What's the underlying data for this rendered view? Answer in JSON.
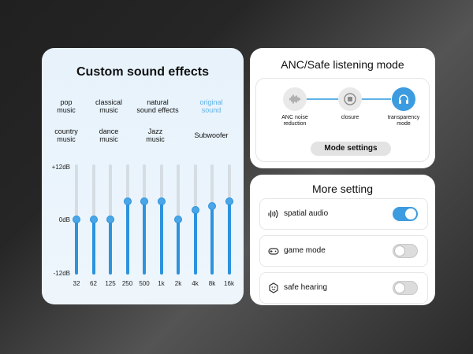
{
  "equalizer": {
    "title": "Custom sound effects",
    "presets": [
      {
        "label": "pop\nmusic",
        "active": false
      },
      {
        "label": "classical\nmusic",
        "active": false
      },
      {
        "label": "natural\nsound effects",
        "active": false
      },
      {
        "label": "original\nsound",
        "active": true
      },
      {
        "label": "country\nmusic",
        "active": false
      },
      {
        "label": "dance\nmusic",
        "active": false
      },
      {
        "label": "Jazz\nmusic",
        "active": false
      },
      {
        "label": "Subwoofer",
        "active": false
      }
    ],
    "y_labels": {
      "top": "+12dB",
      "mid": "0dB",
      "bottom": "-12dB"
    },
    "range": [
      -12,
      12
    ],
    "bands": [
      {
        "freq": "32",
        "gain_db": 0
      },
      {
        "freq": "62",
        "gain_db": 0
      },
      {
        "freq": "125",
        "gain_db": 0
      },
      {
        "freq": "250",
        "gain_db": 4
      },
      {
        "freq": "500",
        "gain_db": 4
      },
      {
        "freq": "1k",
        "gain_db": 4
      },
      {
        "freq": "2k",
        "gain_db": 0
      },
      {
        "freq": "4k",
        "gain_db": 2
      },
      {
        "freq": "8k",
        "gain_db": 3
      },
      {
        "freq": "16k",
        "gain_db": 4
      }
    ],
    "accent": "#2d93dd"
  },
  "anc": {
    "title": "ANC/Safe listening mode",
    "modes": [
      {
        "label": "ANC noise\nreduction",
        "icon": "waveform-icon",
        "active": false
      },
      {
        "label": "closure",
        "icon": "stop-icon",
        "active": false
      },
      {
        "label": "transparency\nmode",
        "icon": "headphones-icon",
        "active": true
      }
    ],
    "settings_button": "Mode settings"
  },
  "more": {
    "title": "More setting",
    "items": [
      {
        "label": "spatial audio",
        "icon": "spatial-audio-icon",
        "on": true
      },
      {
        "label": "game mode",
        "icon": "gamepad-icon",
        "on": false
      },
      {
        "label": "safe hearing",
        "icon": "ear-smile-icon",
        "on": false
      }
    ]
  }
}
